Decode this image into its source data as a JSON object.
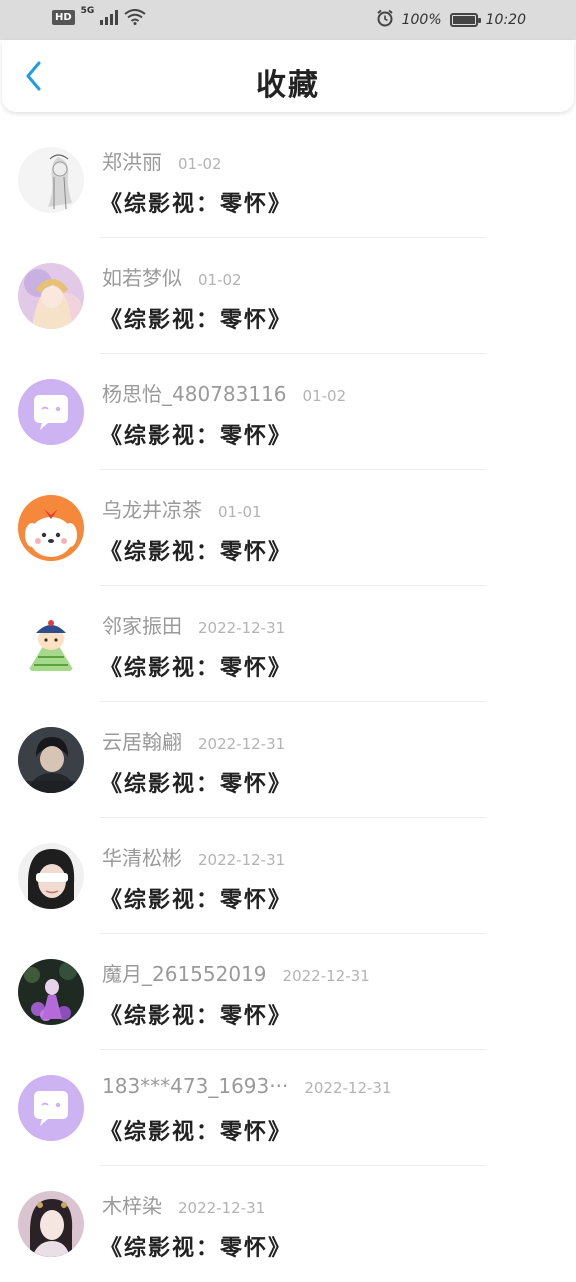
{
  "status_bar": {
    "hd": "HD",
    "network": "5G",
    "battery_percent": "100%",
    "time": "10:20",
    "battery_level": 1.0
  },
  "header": {
    "title": "收藏",
    "back_icon": "chevron-left-icon",
    "accent_color": "#1e9be9"
  },
  "favorites": [
    {
      "name": "郑洪丽",
      "date": "01-02",
      "title": "《综影视：零怀》",
      "avatar": "sketch-girl"
    },
    {
      "name": "如若梦似",
      "date": "01-02",
      "title": "《综影视：零怀》",
      "avatar": "anime-girl"
    },
    {
      "name": "杨思怡_480783116",
      "date": "01-02",
      "title": "《综影视：零怀》",
      "avatar": "default-chat"
    },
    {
      "name": "乌龙井凉茶",
      "date": "01-01",
      "title": "《综影视：零怀》",
      "avatar": "cartoon-dog"
    },
    {
      "name": "邻家振田",
      "date": "2022-12-31",
      "title": "《综影视：零怀》",
      "avatar": "cartoon-zongzi"
    },
    {
      "name": "云居翰翩",
      "date": "2022-12-31",
      "title": "《综影视：零怀》",
      "avatar": "boy-photo"
    },
    {
      "name": "华清松彬",
      "date": "2022-12-31",
      "title": "《综影视：零怀》",
      "avatar": "blindfold-girl"
    },
    {
      "name": "魔月_261552019",
      "date": "2022-12-31",
      "title": "《综影视：零怀》",
      "avatar": "purple-flowers"
    },
    {
      "name": "183***473_1693···",
      "date": "2022-12-31",
      "title": "《综影视：零怀》",
      "avatar": "default-chat"
    },
    {
      "name": "木梓染",
      "date": "2022-12-31",
      "title": "《综影视：零怀》",
      "avatar": "costume-girl"
    }
  ]
}
